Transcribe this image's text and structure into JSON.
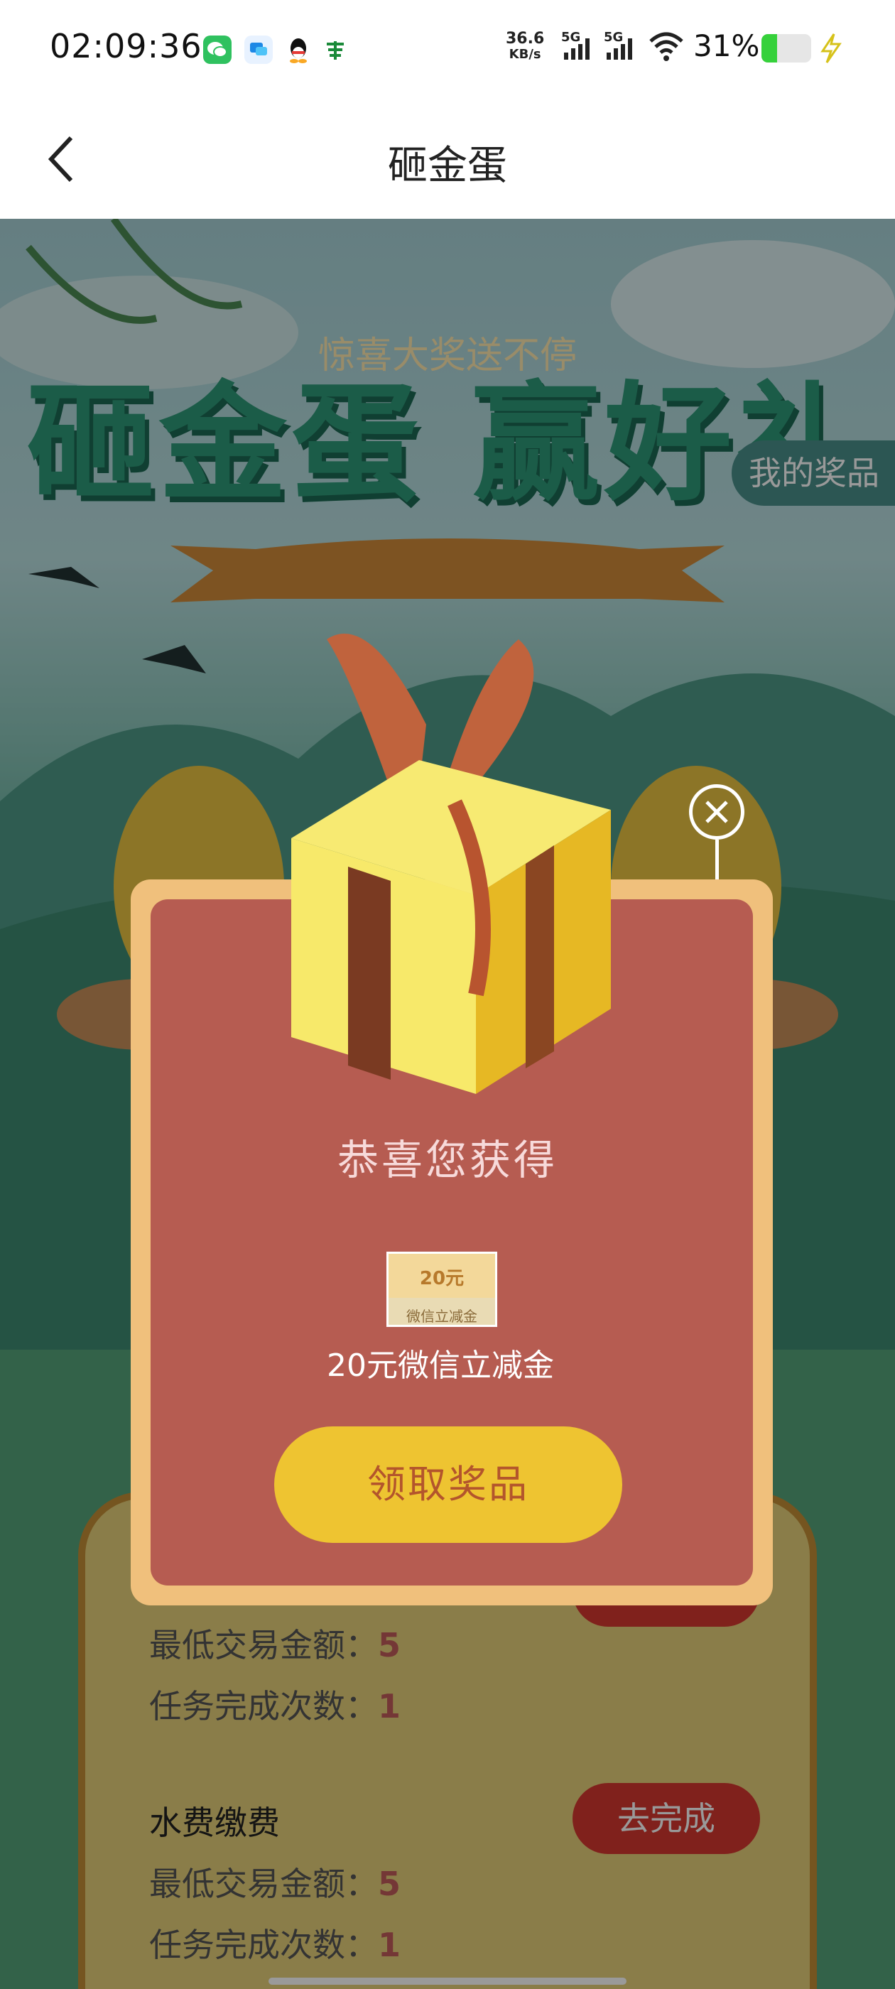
{
  "status_bar": {
    "time": "02:09:36",
    "net_speed_value": "36.6",
    "net_speed_unit": "KB/s",
    "signal_1_label": "5G",
    "signal_2_label": "5G",
    "battery_percent": "31%",
    "battery_level": 0.31,
    "app_icons": [
      "wechat-icon",
      "message-icon",
      "qq-icon",
      "post-bank-icon"
    ]
  },
  "nav": {
    "title": "砸金蛋"
  },
  "banner": {
    "main_title": "砸金蛋 赢好礼",
    "subtitle": "惊喜大奖送不停",
    "my_prize": "我的奖品"
  },
  "modal": {
    "congrats": "恭喜您获得",
    "prize_image_amount": "20元",
    "prize_image_label": "微信立减金",
    "prize_name": "20元微信立减金",
    "claim_button": "领取奖品"
  },
  "tasks": [
    {
      "name": "",
      "min_amount_label": "最低交易金额：",
      "min_amount_value": "5",
      "times_label": "任务完成次数：",
      "times_value": "1",
      "button": "去完成"
    },
    {
      "name": "水费缴费",
      "min_amount_label": "最低交易金额：",
      "min_amount_value": "5",
      "times_label": "任务完成次数：",
      "times_value": "1",
      "button": "去完成"
    }
  ],
  "colors": {
    "modal_bg": "#b65c51",
    "modal_border": "#f0c07c",
    "claim_button": "#eec431",
    "task_button": "#d6372f"
  }
}
